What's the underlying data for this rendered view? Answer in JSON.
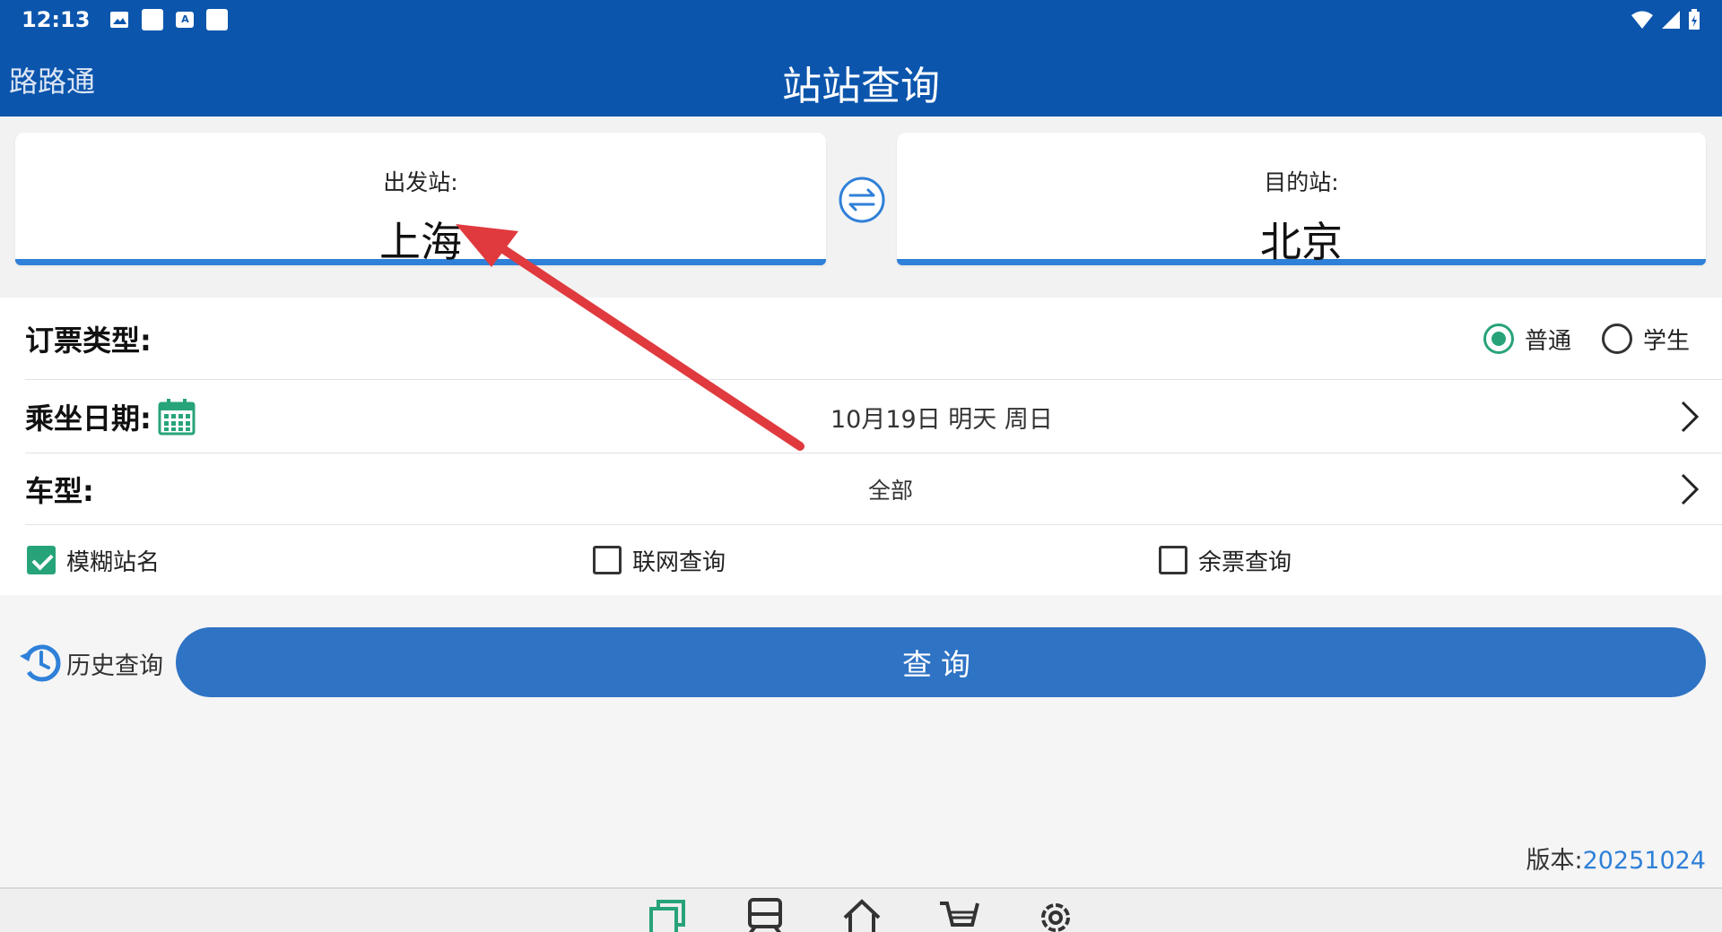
{
  "status_bar": {
    "time": "12:13",
    "notification_icons": [
      "image-icon",
      "square-icon",
      "font-icon",
      "square-icon"
    ],
    "system_icons": [
      "wifi-icon",
      "signal-icon",
      "battery-icon"
    ],
    "notif_a_label": "A"
  },
  "app_bar": {
    "app_name": "路路通",
    "title": "站站查询"
  },
  "stations": {
    "from_label": "出发站:",
    "from_value": "上海",
    "to_label": "目的站:",
    "to_value": "北京"
  },
  "form": {
    "ticket_type_label": "订票类型:",
    "ticket_types": [
      {
        "label": "普通",
        "selected": true
      },
      {
        "label": "学生",
        "selected": false
      }
    ],
    "date_label": "乘坐日期:",
    "date_value": "10月19日 明天 周日",
    "train_type_label": "车型:",
    "train_type_value": "全部",
    "options": [
      {
        "label": "模糊站名",
        "checked": true
      },
      {
        "label": "联网查询",
        "checked": false
      },
      {
        "label": "余票查询",
        "checked": false
      }
    ]
  },
  "actions": {
    "history_label": "历史查询",
    "query_label": "查询"
  },
  "version": {
    "label": "版本:",
    "number": "20251024"
  },
  "bottom_nav": [
    "windows-icon",
    "train-icon",
    "home-icon",
    "cart-icon",
    "settings-icon"
  ],
  "colors": {
    "primary": "#0b55ad",
    "accent_blue": "#2f80d8",
    "query_button": "#2f73c4",
    "check_green": "#27a37a",
    "annotation_arrow": "#e03a3e"
  }
}
